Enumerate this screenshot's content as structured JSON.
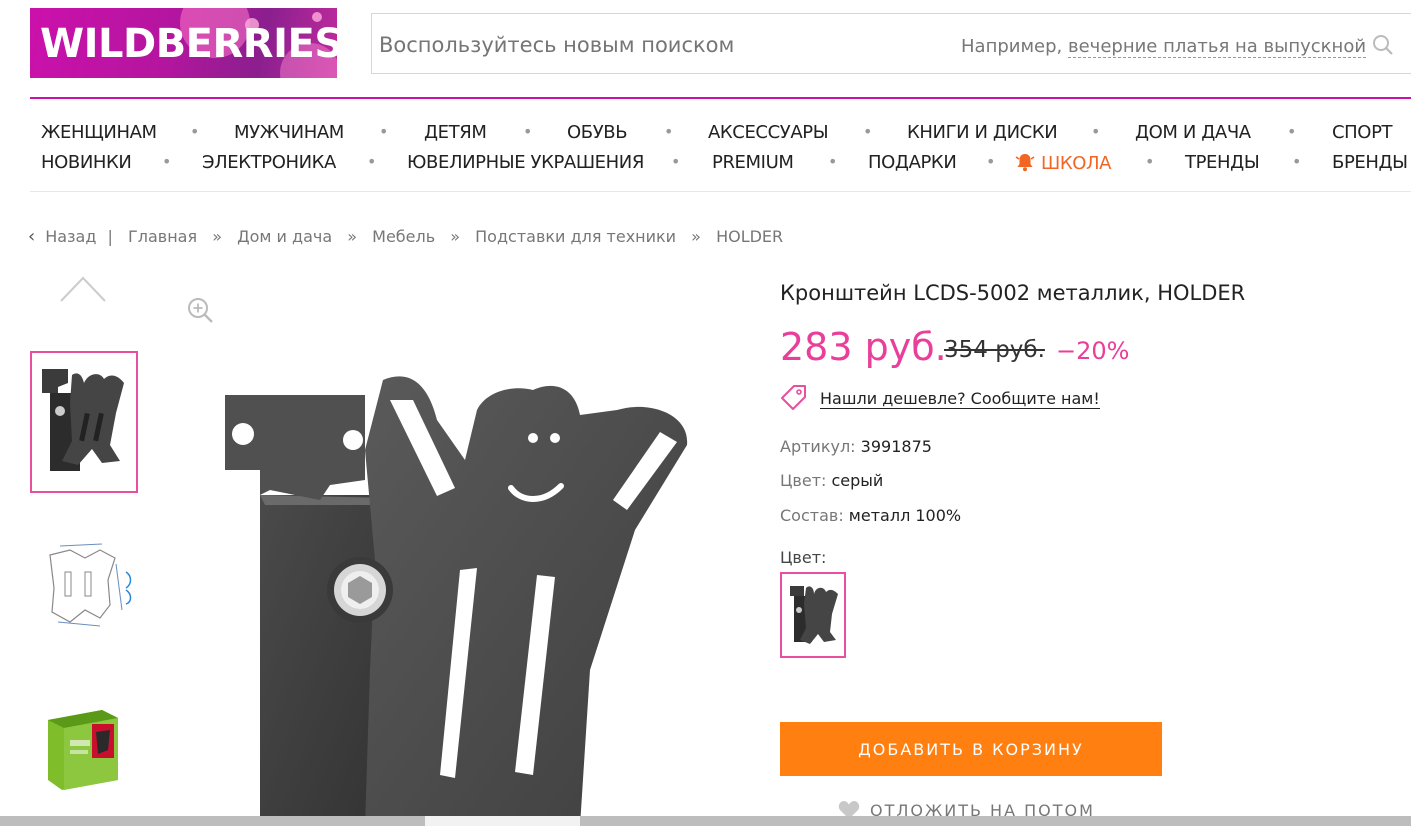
{
  "header": {
    "logo_text": "WILDBERRIES",
    "search": {
      "placeholder": "Воспользуйтесь новым поиском",
      "hint_prefix": "Например,",
      "hint_example": "вечерние платья на выпускной"
    }
  },
  "nav": {
    "row1": [
      "ЖЕНЩИНАМ",
      "МУЖЧИНАМ",
      "ДЕТЯМ",
      "ОБУВЬ",
      "АКСЕССУАРЫ",
      "КНИГИ И ДИСКИ",
      "ДОМ И ДАЧА",
      "СПОРТ"
    ],
    "row2": [
      "НОВИНКИ",
      "ЭЛЕКТРОНИКА",
      "ЮВЕЛИРНЫЕ УКРАШЕНИЯ",
      "PREMIUM",
      "ПОДАРКИ",
      "ШКОЛА",
      "ТРЕНДЫ",
      "БРЕНДЫ"
    ],
    "separator": "•",
    "highlight_color": "#f26522"
  },
  "breadcrumb": {
    "back": "Назад",
    "divider": "|",
    "arrow": "»",
    "items": [
      "Главная",
      "Дом и дача",
      "Мебель",
      "Подставки для техники",
      "HOLDER"
    ]
  },
  "product": {
    "title": "Кронштейн LCDS-5002 металлик, HOLDER",
    "price_new": "283 руб.",
    "price_old": "354 руб.",
    "discount": "−20%",
    "cheaper_link": "Нашли дешевле? Сообщите нам!",
    "props": [
      {
        "key": "Артикул:",
        "value": "3991875"
      },
      {
        "key": "Цвет:",
        "value": "серый"
      },
      {
        "key": "Состав:",
        "value": "металл 100%"
      }
    ],
    "color_label": "Цвет:",
    "add_to_cart": "ДОБАВИТЬ В КОРЗИНУ",
    "defer": "ОТЛОЖИТЬ НА ПОТОМ"
  },
  "colors": {
    "brand_pink": "#cb11ab",
    "price_pink": "#e93e9a",
    "cart_orange": "#ff7f10"
  }
}
